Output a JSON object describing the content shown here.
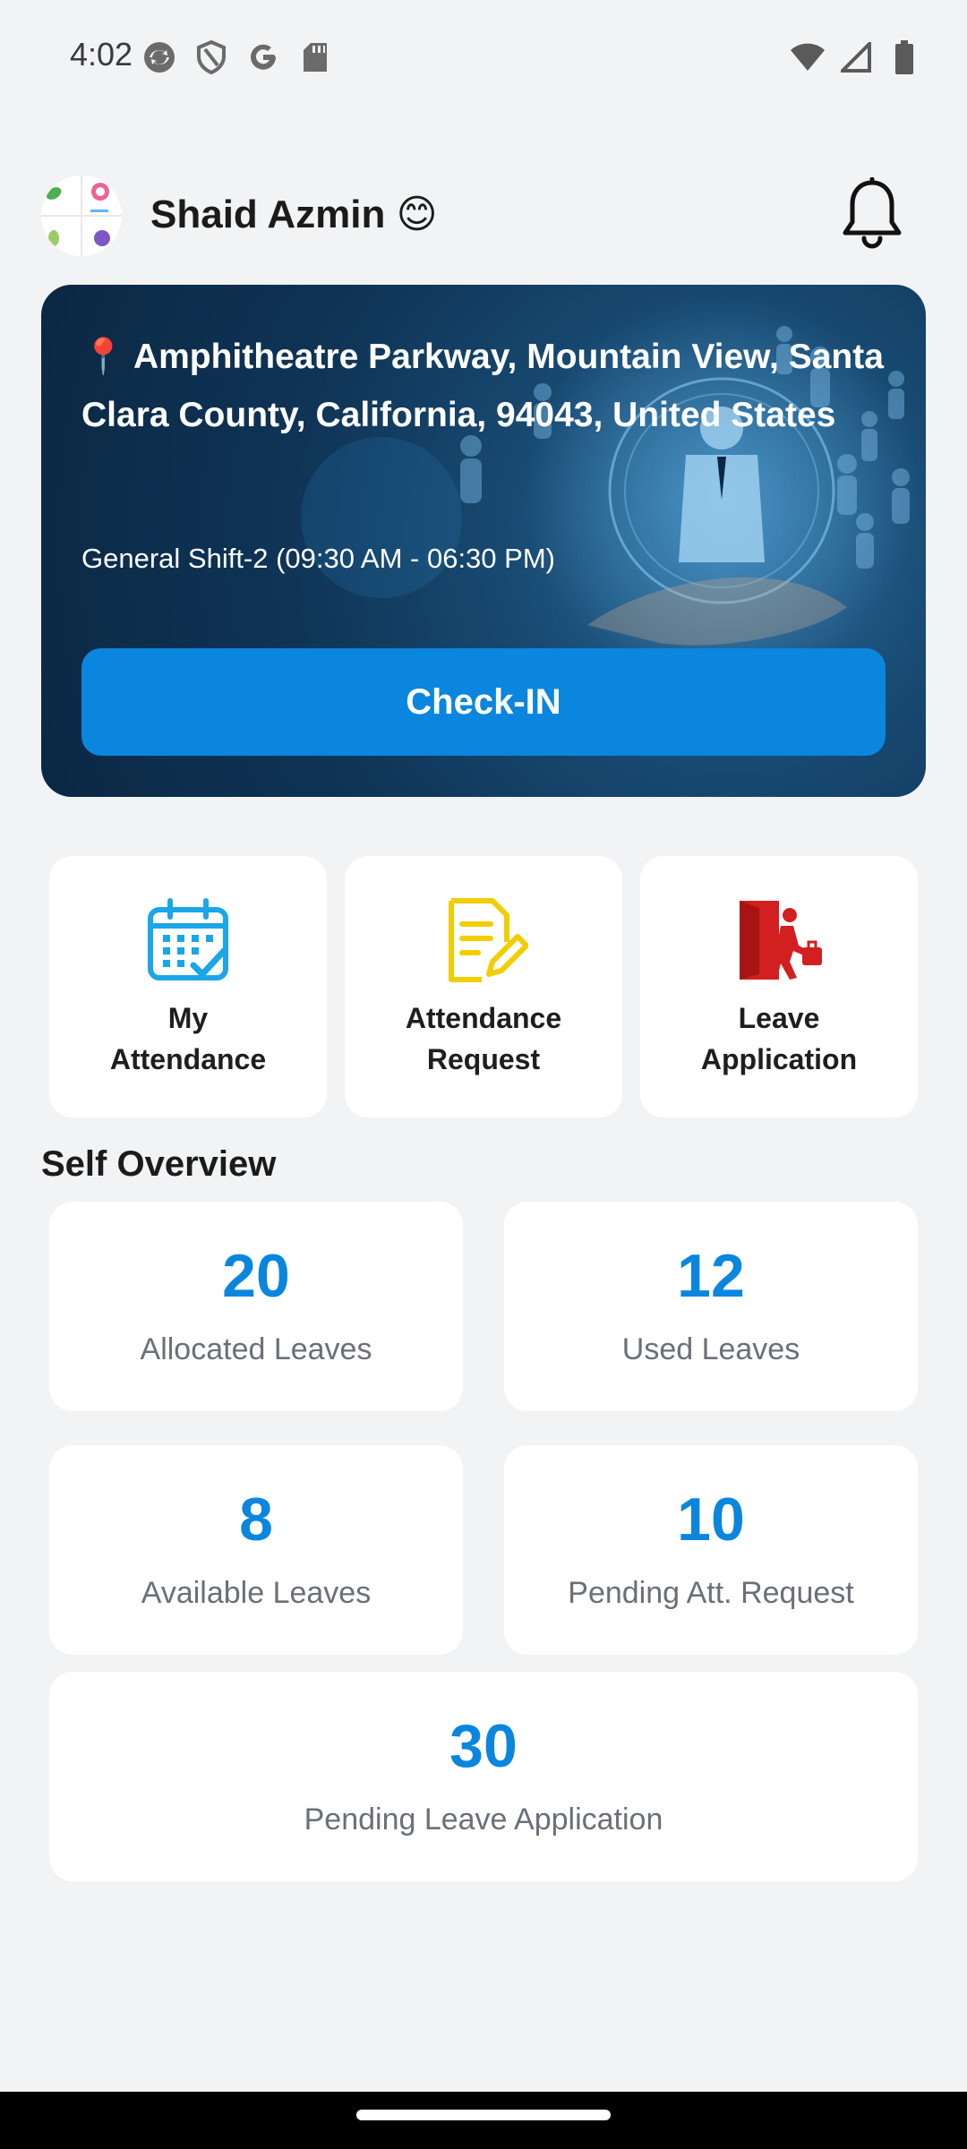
{
  "status_bar": {
    "time": "4:02",
    "left_icons": [
      "sync-icon",
      "shield-icon",
      "google-icon",
      "sd-card-icon"
    ],
    "right_icons": [
      "wifi-icon",
      "signal-icon",
      "battery-icon"
    ]
  },
  "header": {
    "user_name": "Shaid Azmin 😊",
    "bell_icon": "bell-icon"
  },
  "hero": {
    "address": "📍 Amphitheatre Parkway, Mountain View, Santa Clara County, California, 94043, United States",
    "shift": "General Shift-2 (09:30 AM - 06:30 PM)",
    "checkin_label": "Check-IN",
    "button_color": "#0a86de"
  },
  "quick_actions": [
    {
      "label": "My\nAttendance",
      "icon": "calendar-check-icon",
      "color": "#1aa6e8"
    },
    {
      "label": "Attendance\nRequest",
      "icon": "edit-document-icon",
      "color": "#f2cd00"
    },
    {
      "label": "Leave\nApplication",
      "icon": "exit-door-icon",
      "color": "#d21f1f"
    }
  ],
  "overview": {
    "title": "Self Overview",
    "stats": [
      {
        "value": "20",
        "label": "Allocated Leaves"
      },
      {
        "value": "12",
        "label": "Used Leaves"
      },
      {
        "value": "8",
        "label": "Available Leaves"
      },
      {
        "value": "10",
        "label": "Pending Att. Request"
      },
      {
        "value": "30",
        "label": "Pending Leave Application"
      }
    ]
  },
  "colors": {
    "accent": "#0a86de",
    "background": "#f2f3f5"
  }
}
